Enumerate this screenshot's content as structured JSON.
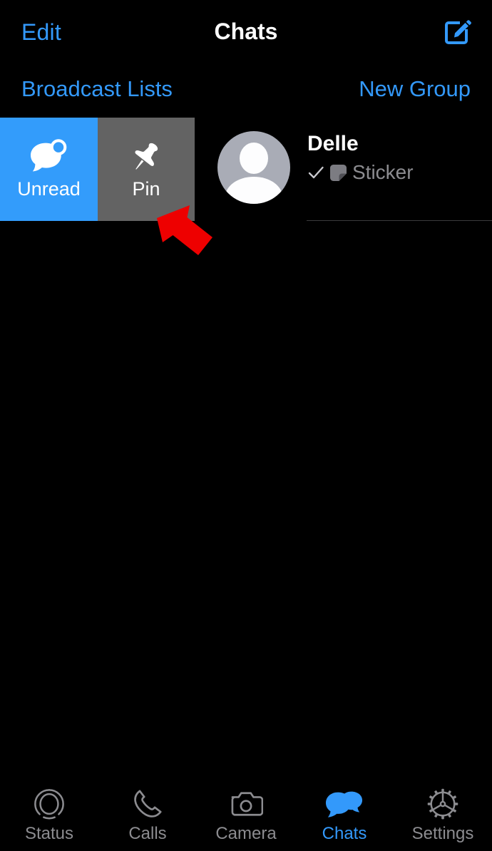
{
  "theme": {
    "background": "#000000",
    "accent_blue": "#3399FB",
    "swipe_unread_blue": "#339CFB",
    "swipe_pin_gray": "#636363",
    "secondary_text": "#8C8C90",
    "pointer_red": "#EE0000",
    "avatar_gray": "#A9ACB6",
    "separator": "#3A3A3C"
  },
  "navbar": {
    "left_button": "Edit",
    "title": "Chats",
    "right_icon": "compose-icon"
  },
  "subbar": {
    "broadcast_lists": "Broadcast Lists",
    "new_group": "New Group"
  },
  "chat_row": {
    "swipe_actions": [
      {
        "label": "Unread",
        "icon": "unread-chat-bubble-icon",
        "color": "#339CFB"
      },
      {
        "label": "Pin",
        "icon": "pin-icon",
        "color": "#636363"
      }
    ],
    "avatar": "default-person-avatar",
    "name": "Delle",
    "status_icon": "single-check-icon",
    "message_type_icon": "sticker-icon",
    "preview": "Sticker"
  },
  "annotation": {
    "pointer": "red-arrow-pointing-to-pin"
  },
  "tabbar": {
    "items": [
      {
        "label": "Status",
        "icon": "status-ring-icon",
        "active": false
      },
      {
        "label": "Calls",
        "icon": "phone-handset-icon",
        "active": false
      },
      {
        "label": "Camera",
        "icon": "camera-icon",
        "active": false
      },
      {
        "label": "Chats",
        "icon": "chat-bubbles-icon",
        "active": true
      },
      {
        "label": "Settings",
        "icon": "gear-icon",
        "active": false
      }
    ]
  }
}
